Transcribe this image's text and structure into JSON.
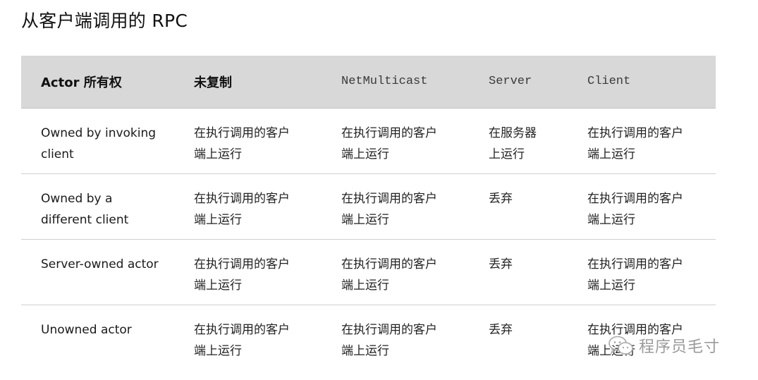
{
  "page": {
    "title": "从客户端调用的 RPC"
  },
  "table": {
    "headers": [
      "Actor 所有权",
      "未复制",
      "NetMulticast",
      "Server",
      "Client"
    ],
    "rows": [
      {
        "owner": "Owned by invoking client",
        "not_replicated": "在执行调用的客户端上运行",
        "net_multicast": "在执行调用的客户端上运行",
        "server": "在服务器上运行",
        "client": "在执行调用的客户端上运行"
      },
      {
        "owner": "Owned by a different client",
        "not_replicated": "在执行调用的客户端上运行",
        "net_multicast": "在执行调用的客户端上运行",
        "server": "丢弃",
        "client": "在执行调用的客户端上运行"
      },
      {
        "owner": "Server-owned actor",
        "not_replicated": "在执行调用的客户端上运行",
        "net_multicast": "在执行调用的客户端上运行",
        "server": "丢弃",
        "client": "在执行调用的客户端上运行"
      },
      {
        "owner": "Unowned actor",
        "not_replicated": "在执行调用的客户端上运行",
        "net_multicast": "在执行调用的客户端上运行",
        "server": "丢弃",
        "client": "在执行调用的客户端上运行"
      }
    ]
  },
  "watermark": {
    "icon": "wechat-icon",
    "text": "程序员毛寸"
  },
  "colors": {
    "header_bg": "#d8d8d8",
    "row_divider": "#cfcfcf",
    "text": "#1a1a1a"
  }
}
